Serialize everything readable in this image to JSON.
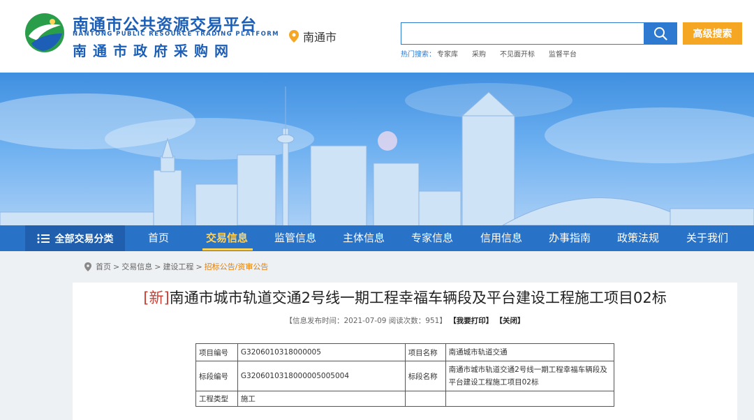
{
  "header": {
    "logo_title": "南通市公共资源交易平台",
    "logo_en": "NANTONG PUBLIC RESOURCE TRADING PLATFORM",
    "logo_sub": "南通市政府采购网",
    "city": "南通市",
    "search_placeholder": "",
    "advanced_search": "高级搜索",
    "hot_label": "热门搜索：",
    "hot_items": [
      "专家库",
      "采购",
      "不见面开标",
      "监督平台"
    ]
  },
  "nav": {
    "all_label": "全部交易分类",
    "items": [
      "首页",
      "交易信息",
      "监管信息",
      "主体信息",
      "专家信息",
      "信用信息",
      "办事指南",
      "政策法规",
      "关于我们"
    ],
    "active_index": 1
  },
  "breadcrumb": [
    "首页",
    "交易信息",
    "建设工程",
    "招标公告/资审公告"
  ],
  "article": {
    "new_tag": "[新]",
    "title": "南通市城市轨道交通2号线一期工程幸福车辆段及平台建设工程施工项目02标",
    "meta_info": "【信息发布时间：2021-07-09  阅读次数：951】",
    "print": "【我要打印】",
    "close": "【关闭】"
  },
  "table": {
    "rows": [
      {
        "k1": "项目编号",
        "v1": "G3206010318000005",
        "k2": "项目名称",
        "v2": "南通城市轨道交通"
      },
      {
        "k1": "标段编号",
        "v1": "G3206010318000005005004",
        "k2": "标段名称",
        "v2": "南通市城市轨道交通2号线一期工程幸福车辆段及平台建设工程施工项目02标"
      },
      {
        "k1": "工程类型",
        "v1": "施工",
        "k2": "",
        "v2": ""
      }
    ]
  },
  "colors": {
    "brand_blue": "#2872c8",
    "accent_orange": "#f5a623",
    "nav_active": "#ffd35a",
    "new_tag_red": "#d23b2f"
  }
}
